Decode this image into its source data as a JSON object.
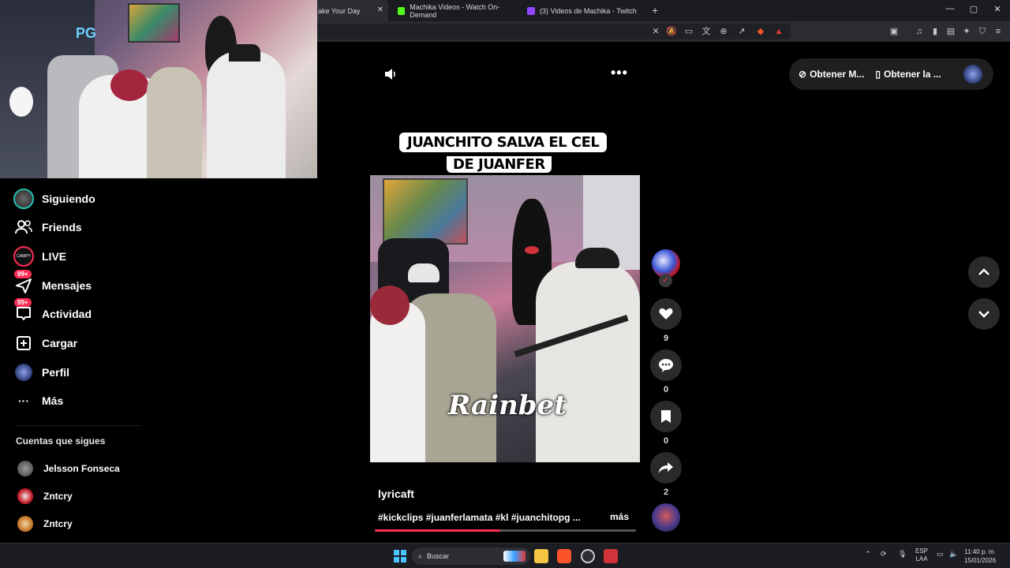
{
  "browser": {
    "tabs": [
      {
        "title": "ake Your Day",
        "active": true
      },
      {
        "title": "Machika Videos - Watch On-Demand"
      },
      {
        "title": "(3) Videos de Machika - Twitch"
      }
    ],
    "new_tab": "+",
    "window_controls": [
      "—",
      "▢",
      "✕"
    ]
  },
  "sidebar": {
    "items": [
      {
        "label": "Siguiendo",
        "icon": "following-avatar-icon"
      },
      {
        "label": "Friends",
        "icon": "friends-icon"
      },
      {
        "label": "LIVE",
        "icon": "live-icon"
      },
      {
        "label": "Mensajes",
        "icon": "messages-icon",
        "badge": "99+"
      },
      {
        "label": "Actividad",
        "icon": "activity-icon",
        "badge": "99+"
      },
      {
        "label": "Cargar",
        "icon": "upload-icon"
      },
      {
        "label": "Perfil",
        "icon": "profile-avatar-icon"
      },
      {
        "label": "Más",
        "icon": "more-icon"
      }
    ],
    "following_title": "Cuentas que sigues",
    "following": [
      {
        "name": "Jelsson Fonseca"
      },
      {
        "name": "Zntcry"
      },
      {
        "name": "Zntcry"
      }
    ]
  },
  "video": {
    "caption_line1": "JUANCHITO SALVA EL CEL",
    "caption_line2": "DE JUANFER",
    "watermark": "Rainbet",
    "author": "lyricaft",
    "description": "#kickclips #juanferlamata #kl #juanchitopg ...",
    "more_label": "más",
    "progress": 0.48,
    "menu_dots": "•••"
  },
  "actions": {
    "likes": "9",
    "comments": "0",
    "saves": "0",
    "shares": "2",
    "follow_check": "✓"
  },
  "topright": {
    "coins_label": "Obtener M...",
    "app_label": "Obtener la ..."
  },
  "taskbar": {
    "search_placeholder": "Buscar",
    "lang_top": "ESP",
    "lang_bottom": "LAA",
    "time": "11:40 p. m.",
    "date": "15/01/2026"
  },
  "colors": {
    "accent": "#fe2c55",
    "background": "#000000",
    "button_bg": "#2a2a2a"
  }
}
